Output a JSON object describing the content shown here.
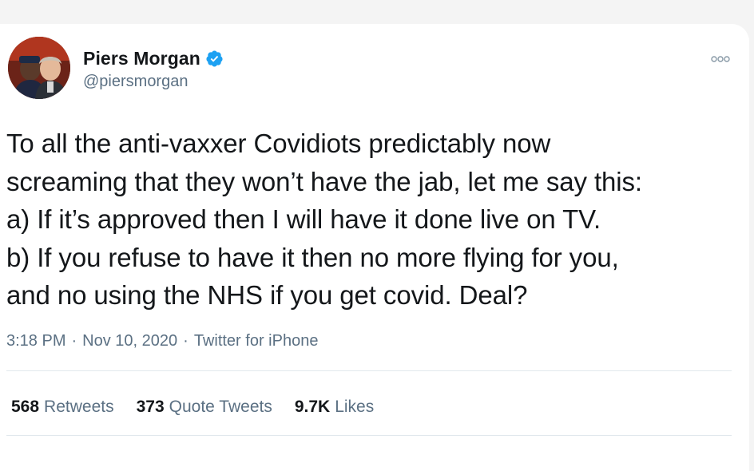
{
  "tweet": {
    "author": {
      "name": "Piers Morgan",
      "handle": "@piersmorgan",
      "verified": true
    },
    "text": "To all the anti-vaxxer Covidiots predictably now\nscreaming that they won’t have the jab, let me say this:\na) If it’s approved then I will have it done live on TV.\nb) If you refuse to have it then no more flying for you,\nand no using the NHS if you get covid. Deal?",
    "time": "3:18 PM",
    "date": "Nov 10, 2020",
    "source": "Twitter for iPhone",
    "separator": "·",
    "stats": {
      "retweets": {
        "count": "568",
        "label": "Retweets"
      },
      "quote_tweets": {
        "count": "373",
        "label": "Quote Tweets"
      },
      "likes": {
        "count": "9.7K",
        "label": "Likes"
      }
    }
  },
  "icons": {
    "verified": "verified-badge-icon",
    "more": "more-options-icon"
  },
  "colors": {
    "text": "#14171a",
    "secondary": "#5b7083",
    "verified": "#1da1f2",
    "divider": "#e1e8ed"
  }
}
